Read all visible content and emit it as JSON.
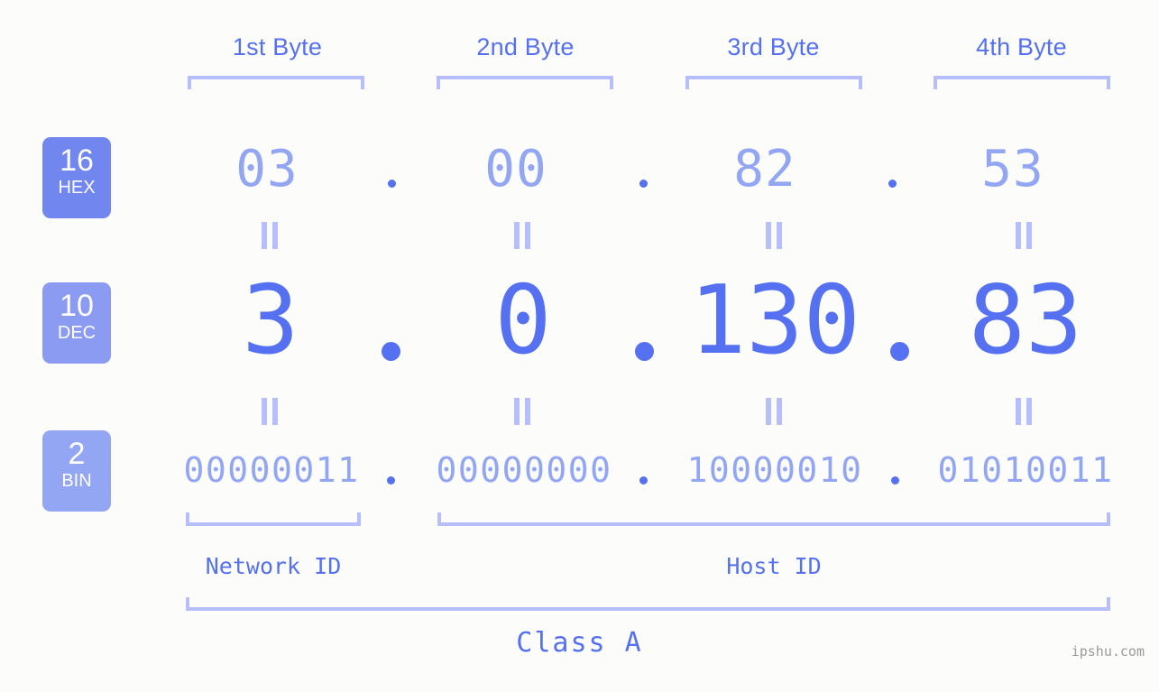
{
  "background_color": "#fcfdfa",
  "accent_color": "#5570f1",
  "light_accent_color": "#93a6f4",
  "bracket_color": "#b6bffb",
  "header": {
    "byte_labels": [
      "1st Byte",
      "2nd Byte",
      "3rd Byte",
      "4th Byte"
    ]
  },
  "rows": [
    {
      "badge_number": "16",
      "badge_base": "HEX",
      "badge_color": "#7186ef",
      "values": [
        "03",
        "00",
        "82",
        "53"
      ],
      "separator": "."
    },
    {
      "badge_number": "10",
      "badge_base": "DEC",
      "badge_color": "#8c9bf2",
      "values": [
        "3",
        "0",
        "130",
        "83"
      ],
      "separator": "."
    },
    {
      "badge_number": "2",
      "badge_base": "BIN",
      "badge_color": "#93a6f4",
      "values": [
        "00000011",
        "00000000",
        "10000010",
        "01010011"
      ],
      "separator": "."
    }
  ],
  "equality_marker": "||",
  "footer": {
    "network_id_label": "Network ID",
    "host_id_label": "Host ID",
    "class_label": "Class A"
  },
  "watermark": "ipshu.com"
}
